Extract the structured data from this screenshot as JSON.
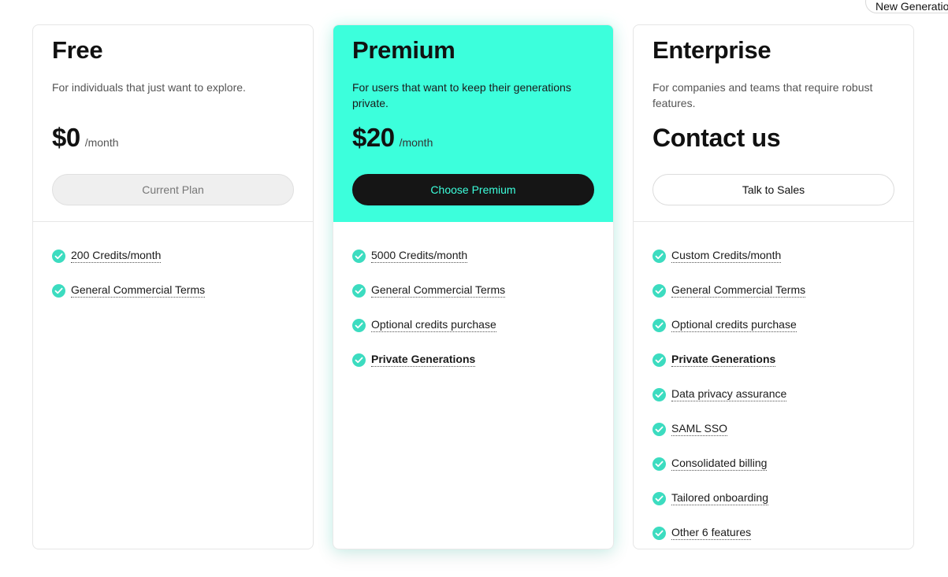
{
  "top_pill": {
    "label": "New Generation"
  },
  "plans": [
    {
      "name": "Free",
      "description": "For individuals that just want to explore.",
      "price": "$0",
      "period": "/month",
      "button": "Current Plan",
      "features": [
        {
          "label": "200 Credits/month",
          "bold": false
        },
        {
          "label": "General Commercial Terms",
          "bold": false
        }
      ]
    },
    {
      "name": "Premium",
      "description": "For users that want to keep their generations private.",
      "price": "$20",
      "period": "/month",
      "button": "Choose Premium",
      "features": [
        {
          "label": "5000 Credits/month",
          "bold": false
        },
        {
          "label": "General Commercial Terms",
          "bold": false
        },
        {
          "label": "Optional credits purchase",
          "bold": false
        },
        {
          "label": "Private Generations",
          "bold": true
        }
      ]
    },
    {
      "name": "Enterprise",
      "description": "For companies and teams that require robust features.",
      "price": "Contact us",
      "button": "Talk to Sales",
      "features": [
        {
          "label": "Custom Credits/month",
          "bold": false
        },
        {
          "label": "General Commercial Terms",
          "bold": false
        },
        {
          "label": "Optional credits purchase",
          "bold": false
        },
        {
          "label": "Private Generations",
          "bold": true
        },
        {
          "label": "Data privacy assurance",
          "bold": false
        },
        {
          "label": "SAML SSO",
          "bold": false
        },
        {
          "label": "Consolidated billing",
          "bold": false
        },
        {
          "label": "Tailored onboarding",
          "bold": false
        },
        {
          "label": "Other 6 features",
          "bold": false
        }
      ]
    }
  ],
  "colors": {
    "accent": "#3cffdc",
    "check": "#3cdcc0",
    "dark_button": "#151515"
  },
  "icons": {
    "feature": "check-circle-icon"
  }
}
